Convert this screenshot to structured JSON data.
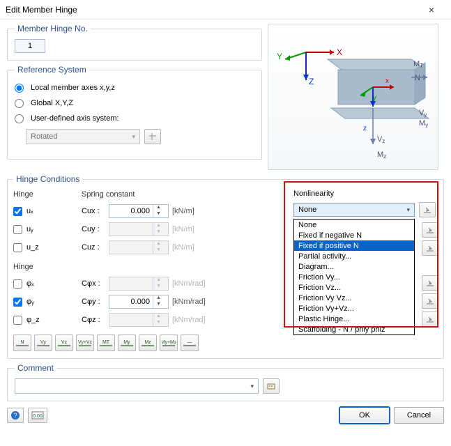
{
  "titlebar": {
    "title": "Edit Member Hinge"
  },
  "member_no": {
    "label": "Member Hinge No.",
    "value": "1"
  },
  "reference": {
    "legend": "Reference System",
    "opt_local": "Local member axes x,y,z",
    "opt_global": "Global X,Y,Z",
    "opt_user": "User-defined axis system:",
    "rotated": "Rotated"
  },
  "hinge": {
    "legend": "Hinge Conditions",
    "hdr_hinge": "Hinge",
    "hdr_spring": "Spring constant",
    "hdr_nonlin": "Nonlinearity",
    "rows_t": [
      {
        "id": "ux",
        "hlabel": "uₓ",
        "clabel": "Cux :",
        "checked": true,
        "value": "0.000",
        "unit": "[kN/m]"
      },
      {
        "id": "uy",
        "hlabel": "uᵧ",
        "clabel": "Cuy :",
        "checked": false,
        "value": "",
        "unit": "[kN/m]"
      },
      {
        "id": "uz",
        "hlabel": "u_z",
        "clabel": "Cuz :",
        "checked": false,
        "value": "",
        "unit": "[kN/m]"
      }
    ],
    "rows_r": [
      {
        "id": "px",
        "hlabel": "φₓ",
        "clabel": "Cφx :",
        "checked": false,
        "value": "",
        "unit": "[kNm/rad]"
      },
      {
        "id": "py",
        "hlabel": "φᵧ",
        "clabel": "Cφy :",
        "checked": true,
        "value": "0.000",
        "unit": "[kNm/rad]"
      },
      {
        "id": "pz",
        "hlabel": "φ_z",
        "clabel": "Cφz :",
        "checked": false,
        "value": "",
        "unit": "[kNm/rad]"
      }
    ],
    "nonlin_selected": "None",
    "nonlin_options": [
      "None",
      "Fixed if negative N",
      "Fixed if positive N",
      "Partial activity...",
      "Diagram...",
      "Friction Vy...",
      "Friction Vz...",
      "Friction Vy Vz...",
      "Friction Vy+Vz...",
      "Plastic Hinge...",
      "Scaffolding - N / phiy phiz"
    ],
    "nonlin_highlight_index": 2
  },
  "btnstrip": {
    "labels": [
      "N",
      "Vy",
      "Vz",
      "Vy+Vz",
      "MT",
      "My",
      "Mz",
      "My+Mz",
      "—"
    ]
  },
  "comment": {
    "legend": "Comment",
    "value": ""
  },
  "footer": {
    "ok": "OK",
    "cancel": "Cancel"
  }
}
